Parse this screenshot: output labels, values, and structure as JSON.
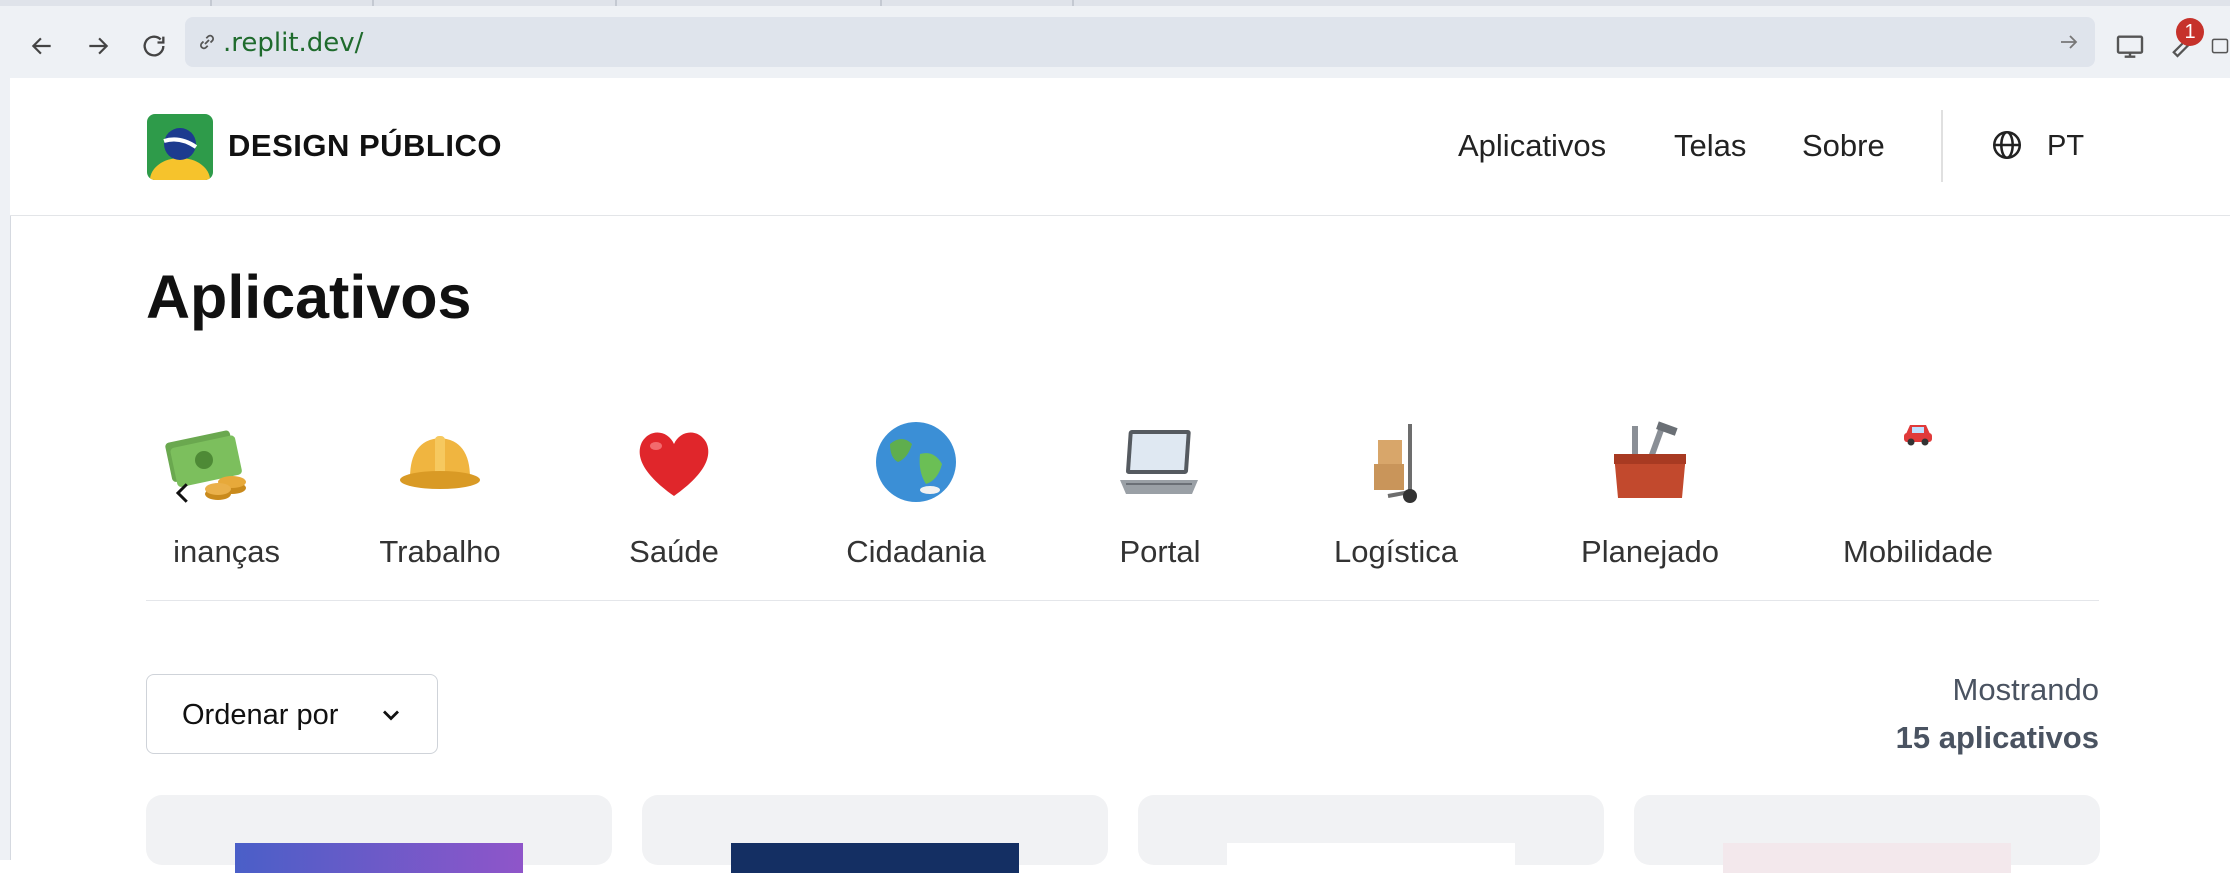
{
  "browser": {
    "url": ".replit.dev/",
    "extension_badge": "1"
  },
  "header": {
    "brand_bold": "DESIGN",
    "brand_rest": "PÚBLICO",
    "nav": [
      {
        "label": "Aplicativos"
      },
      {
        "label": "Telas"
      },
      {
        "label": "Sobre"
      }
    ],
    "language": "PT"
  },
  "main": {
    "title": "Aplicativos",
    "categories": [
      {
        "label": "inanças",
        "icon": "money-coins-icon"
      },
      {
        "label": "Trabalho",
        "icon": "hard-hat-icon"
      },
      {
        "label": "Saúde",
        "icon": "heart-icon"
      },
      {
        "label": "Cidadania",
        "icon": "globe-icon"
      },
      {
        "label": "Portal",
        "icon": "laptop-icon"
      },
      {
        "label": "Logística",
        "icon": "hand-truck-icon"
      },
      {
        "label": "Planejado",
        "icon": "toolbox-icon"
      },
      {
        "label": "Mobilidade",
        "icon": "car-icon"
      }
    ],
    "sort_label": "Ordenar por",
    "count_prefix": "Mostrando",
    "count_text": "15 aplicativos"
  },
  "colors": {
    "brand_green": "#2e9b4a",
    "brand_yellow": "#f6c32c",
    "brand_blue": "#1d3b8f",
    "text_muted": "#4a5361",
    "badge_red": "#c6322b"
  }
}
